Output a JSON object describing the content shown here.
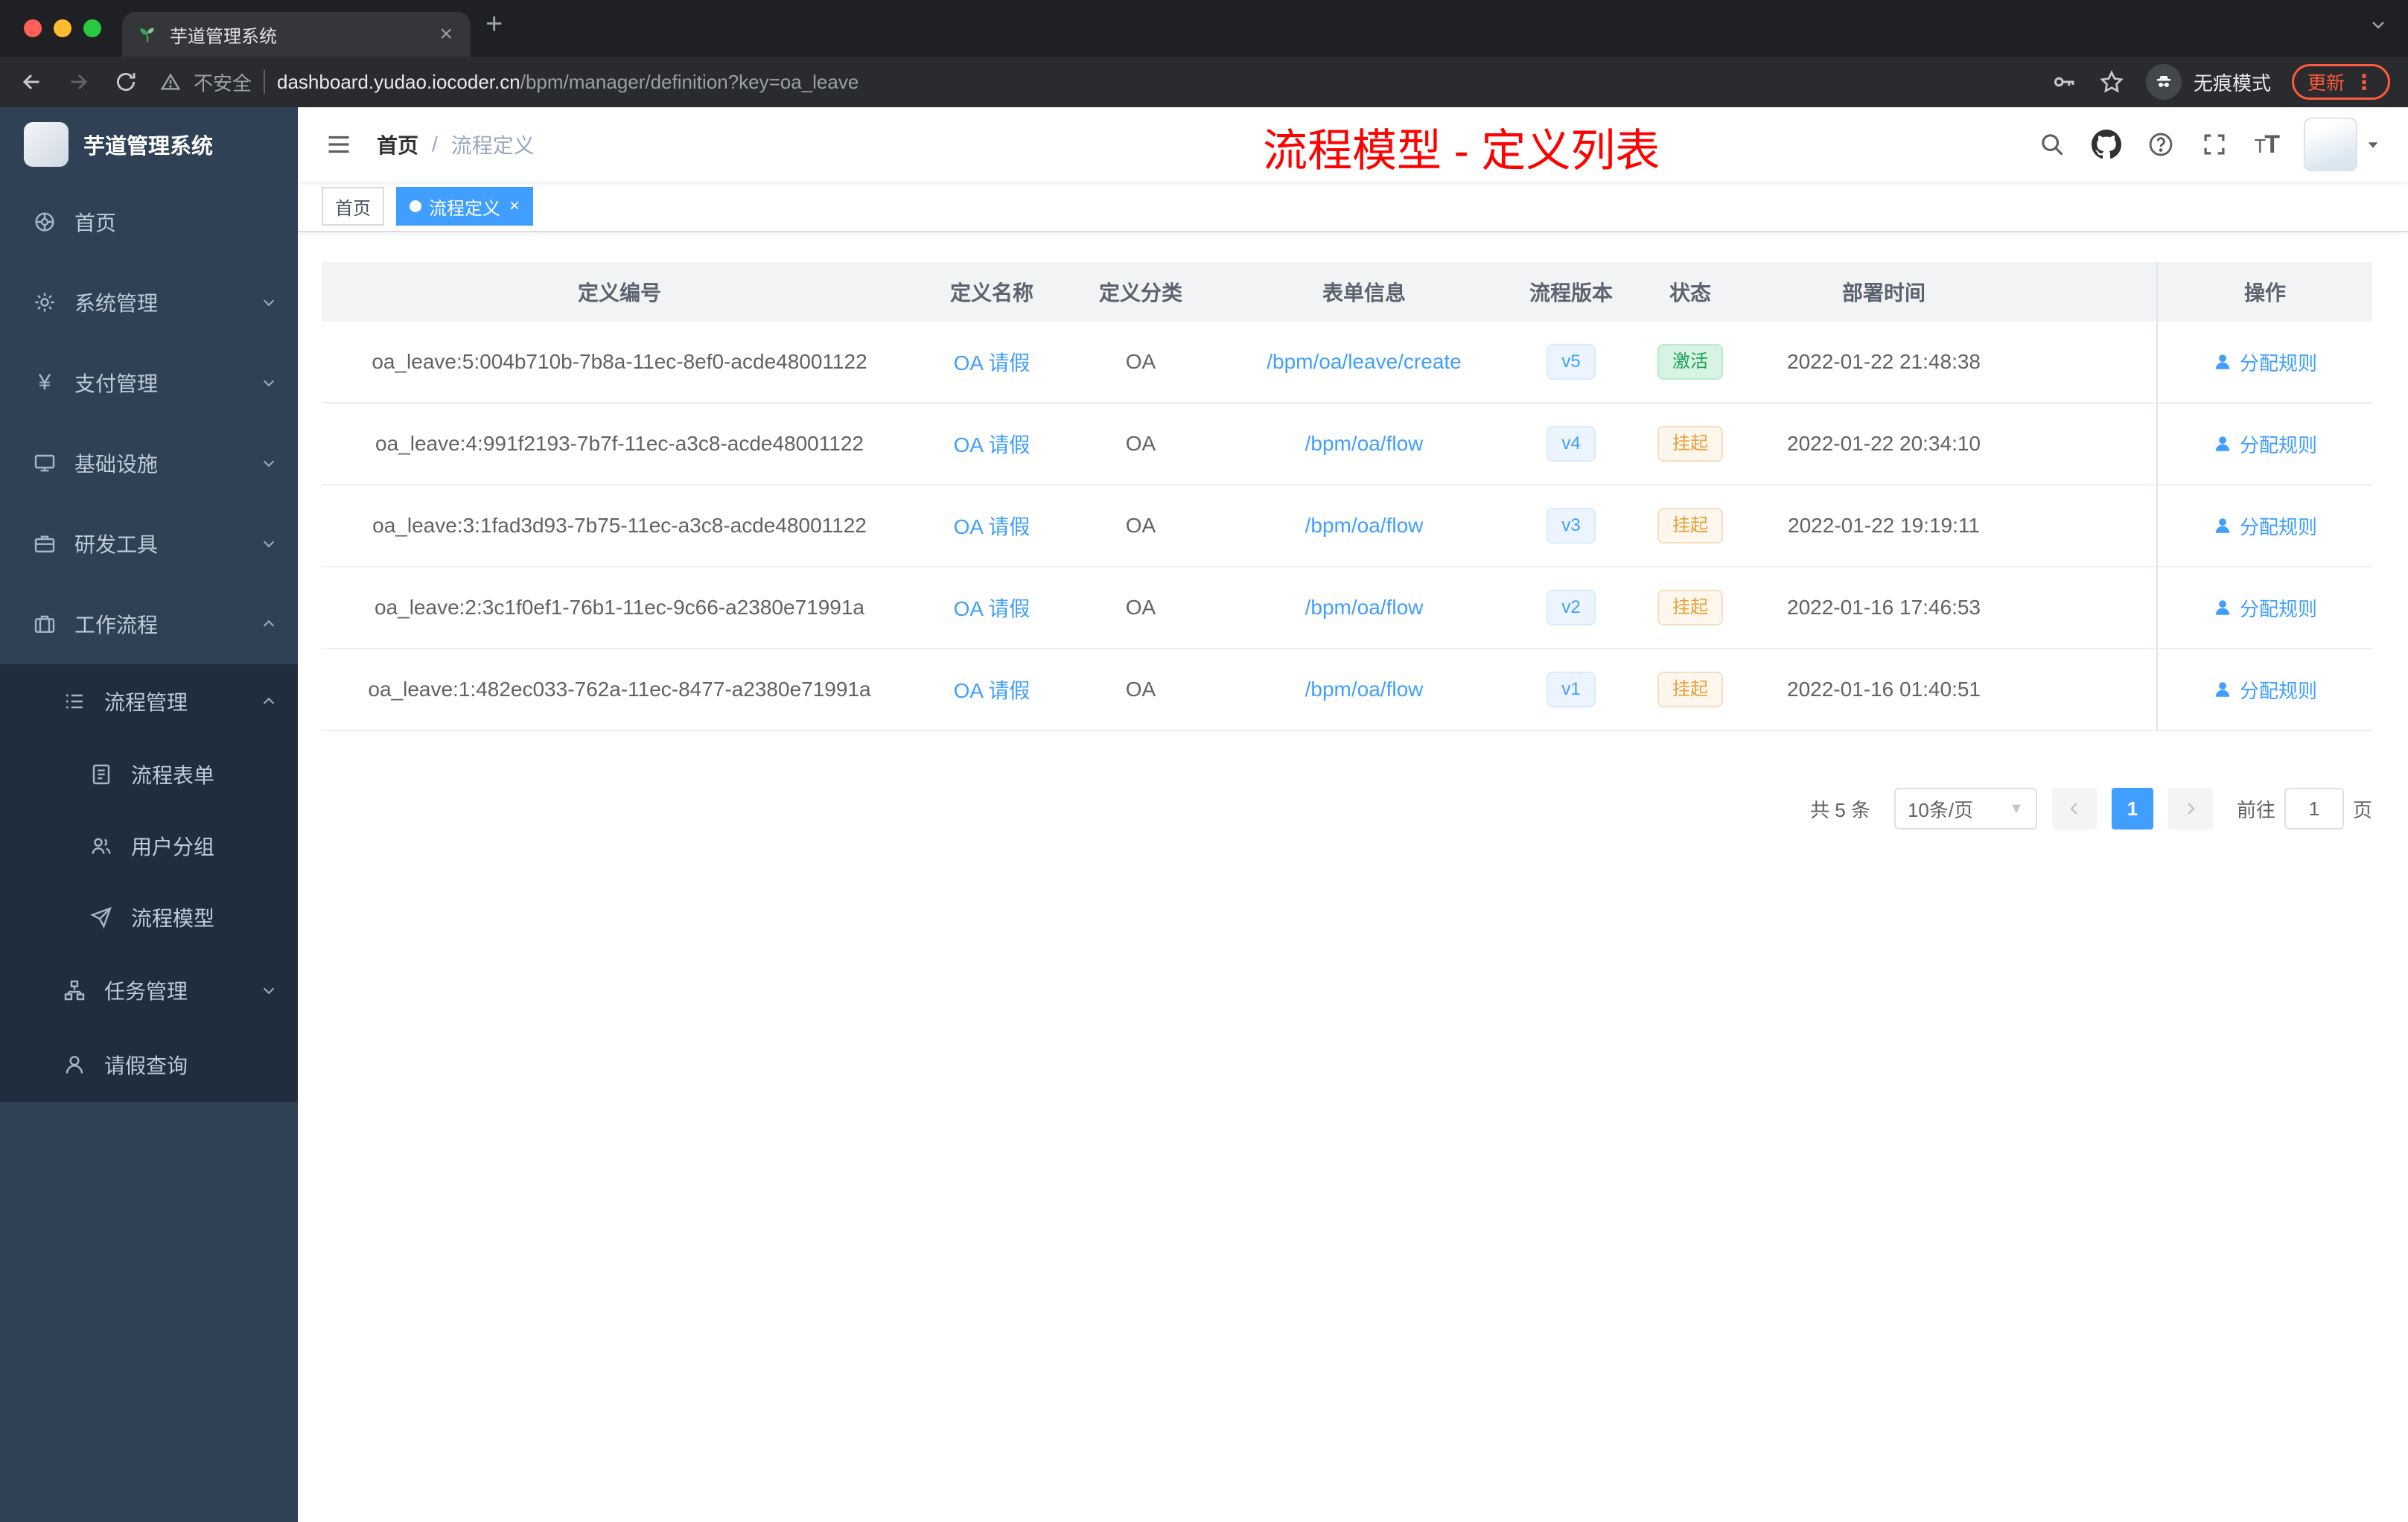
{
  "chrome": {
    "tab_title": "芋道管理系统",
    "security_label": "不安全",
    "url_host": "dashboard.yudao.iocoder.cn",
    "url_path": "/bpm/manager/definition?key=oa_leave",
    "incognito_label": "无痕模式",
    "update_label": "更新"
  },
  "sidebar": {
    "logo_title": "芋道管理系统",
    "menu": [
      {
        "label": "首页"
      },
      {
        "label": "系统管理"
      },
      {
        "label": "支付管理"
      },
      {
        "label": "基础设施"
      },
      {
        "label": "研发工具"
      },
      {
        "label": "工作流程"
      },
      {
        "label": "流程管理"
      },
      {
        "label": "流程表单"
      },
      {
        "label": "用户分组"
      },
      {
        "label": "流程模型"
      },
      {
        "label": "任务管理"
      },
      {
        "label": "请假查询"
      }
    ]
  },
  "header": {
    "breadcrumb": {
      "home": "首页",
      "separator": "/",
      "current": "流程定义"
    },
    "annotation": "流程模型 - 定义列表"
  },
  "tags": {
    "items": [
      {
        "label": "首页",
        "active": false
      },
      {
        "label": "流程定义",
        "active": true
      }
    ]
  },
  "table": {
    "columns": [
      "定义编号",
      "定义名称",
      "定义分类",
      "表单信息",
      "流程版本",
      "状态",
      "部署时间",
      "操作"
    ],
    "action_label": "分配规则",
    "rows": [
      {
        "id": "oa_leave:5:004b710b-7b8a-11ec-8ef0-acde48001122",
        "name": "OA 请假",
        "category": "OA",
        "form": "/bpm/oa/leave/create",
        "version": "v5",
        "status": "激活",
        "status_type": "success",
        "time": "2022-01-22 21:48:38"
      },
      {
        "id": "oa_leave:4:991f2193-7b7f-11ec-a3c8-acde48001122",
        "name": "OA 请假",
        "category": "OA",
        "form": "/bpm/oa/flow",
        "version": "v4",
        "status": "挂起",
        "status_type": "warning",
        "time": "2022-01-22 20:34:10"
      },
      {
        "id": "oa_leave:3:1fad3d93-7b75-11ec-a3c8-acde48001122",
        "name": "OA 请假",
        "category": "OA",
        "form": "/bpm/oa/flow",
        "version": "v3",
        "status": "挂起",
        "status_type": "warning",
        "time": "2022-01-22 19:19:11"
      },
      {
        "id": "oa_leave:2:3c1f0ef1-76b1-11ec-9c66-a2380e71991a",
        "name": "OA 请假",
        "category": "OA",
        "form": "/bpm/oa/flow",
        "version": "v2",
        "status": "挂起",
        "status_type": "warning",
        "time": "2022-01-16 17:46:53"
      },
      {
        "id": "oa_leave:1:482ec033-762a-11ec-8477-a2380e71991a",
        "name": "OA 请假",
        "category": "OA",
        "form": "/bpm/oa/flow",
        "version": "v1",
        "status": "挂起",
        "status_type": "warning",
        "time": "2022-01-16 01:40:51"
      }
    ]
  },
  "pagination": {
    "total": "共 5 条",
    "page_size": "10条/页",
    "current_page": "1",
    "goto_label": "前往",
    "goto_value": "1",
    "page_unit": "页"
  },
  "colors": {
    "accent": "#409eff",
    "annotation": "#fe0100",
    "status_active": "#18a058",
    "status_suspended": "#e6a23c",
    "sidebar_bg": "#304156",
    "submenu_bg": "#1f2d3d"
  }
}
